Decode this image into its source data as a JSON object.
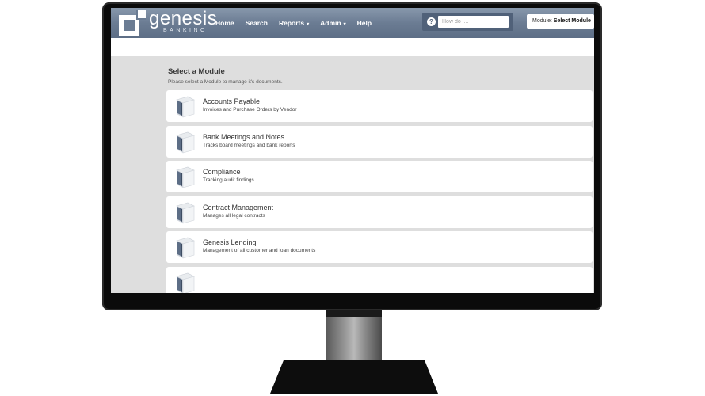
{
  "brand": {
    "name": "genesis",
    "tagline": "BANKINC"
  },
  "nav": {
    "items": [
      {
        "label": "Home",
        "dropdown": false
      },
      {
        "label": "Search",
        "dropdown": false
      },
      {
        "label": "Reports",
        "dropdown": true
      },
      {
        "label": "Admin",
        "dropdown": true
      },
      {
        "label": "Help",
        "dropdown": false
      }
    ],
    "caret": "▾"
  },
  "search": {
    "help_glyph": "?",
    "placeholder": "How do I..."
  },
  "module_select": {
    "label": "Module:",
    "value": "Select Module",
    "caret": "▾"
  },
  "main": {
    "title": "Select a Module",
    "subtitle": "Please select a Module to manage it's documents.",
    "modules": [
      {
        "name": "Accounts Payable",
        "description": "Invoices and Purchase Orders by Vendor"
      },
      {
        "name": "Bank Meetings and Notes",
        "description": "Tracks board meetings and bank reports"
      },
      {
        "name": "Compliance",
        "description": "Tracking audit findings"
      },
      {
        "name": "Contract Management",
        "description": "Manages all legal contracts"
      },
      {
        "name": "Genesis Lending",
        "description": "Management of all customer and loan documents"
      },
      {
        "name": "",
        "description": ""
      }
    ]
  },
  "colors": {
    "header": "#6b7c93",
    "content_bg": "#dedede",
    "card_bg": "#ffffff",
    "icon_accent": "#5d6e86"
  },
  "icons": {
    "module": "module-cube-icon",
    "help": "help-circle-icon"
  }
}
